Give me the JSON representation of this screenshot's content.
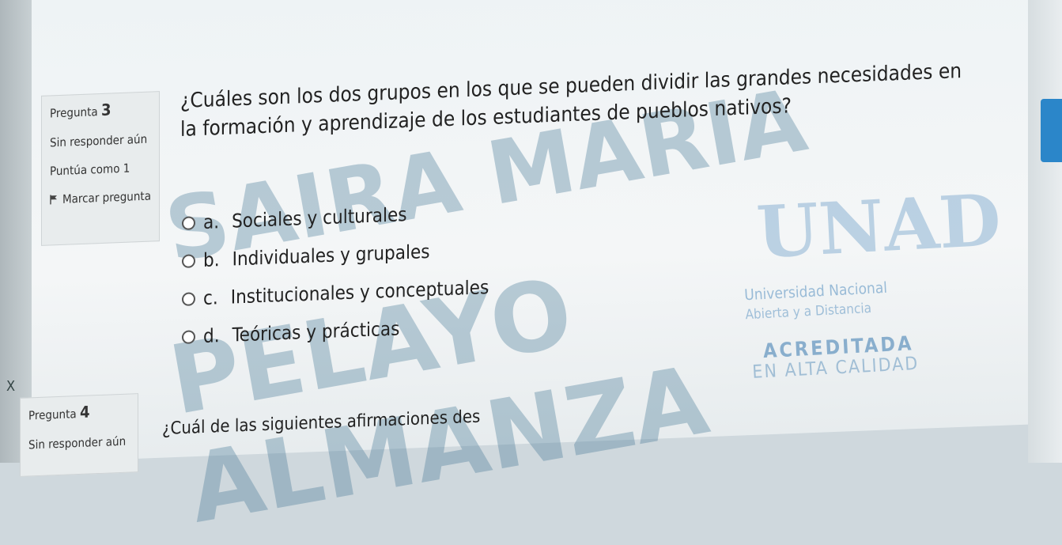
{
  "question3": {
    "label_prefix": "Pregunta",
    "number": "3",
    "status": "Sin responder aún",
    "score": "Puntúa como 1",
    "flag_label": "Marcar pregunta",
    "text": "¿Cuáles son los dos grupos en los que se pueden dividir las grandes necesidades en la formación y aprendizaje de los estudiantes de pueblos nativos?",
    "answers": [
      {
        "letter": "a.",
        "text": "Sociales y culturales"
      },
      {
        "letter": "b.",
        "text": "Individuales y grupales"
      },
      {
        "letter": "c.",
        "text": "Institucionales y conceptuales"
      },
      {
        "letter": "d.",
        "text": "Teóricas y prácticas"
      }
    ]
  },
  "question4": {
    "label_prefix": "Pregunta",
    "number": "4",
    "status": "Sin responder aún",
    "text": "¿Cuál de las siguientes afirmaciones des"
  },
  "watermarks": {
    "line1": "SAIRA MARIA",
    "line2": "PELAYO ALMANZA"
  },
  "logo": {
    "letters": "UNAD",
    "line1": "Universidad Nacional",
    "line2": "Abierta y a Distancia",
    "line3": "ACREDITADA",
    "line4": "EN ALTA CALIDAD"
  },
  "misc": {
    "x_mark": "X"
  },
  "colors": {
    "accent_blue": "#2b86c9",
    "page_bg": "#f4f6f7"
  }
}
